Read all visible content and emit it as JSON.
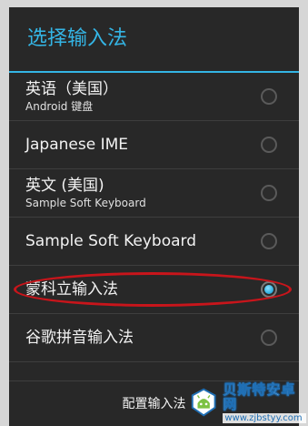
{
  "dialog": {
    "title": "选择输入法",
    "items": [
      {
        "label": "英语（美国）",
        "sublabel": "Android 键盘",
        "checked": false
      },
      {
        "label": "Japanese IME",
        "sublabel": "",
        "checked": false
      },
      {
        "label": "英文 (美国)",
        "sublabel": "Sample Soft Keyboard",
        "checked": false
      },
      {
        "label": "Sample Soft Keyboard",
        "sublabel": "",
        "checked": false
      },
      {
        "label": "蒙科立输入法",
        "sublabel": "",
        "checked": true
      },
      {
        "label": "谷歌拼音输入法",
        "sublabel": "",
        "checked": false
      }
    ],
    "footer_label": "配置输入法"
  },
  "colors": {
    "accent": "#34b5e5",
    "dialog_bg": "#282828",
    "annotation": "#c8151b"
  },
  "watermark": {
    "name": "贝斯特安卓网",
    "url": "www.zjbstyy.com"
  }
}
